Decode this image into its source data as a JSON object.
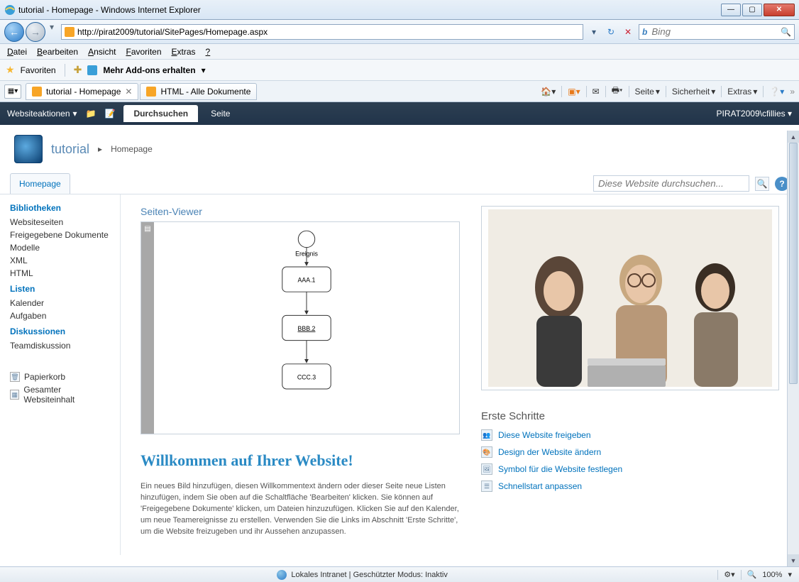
{
  "window": {
    "title": "tutorial - Homepage - Windows Internet Explorer"
  },
  "addressbar": {
    "url": "http://pirat2009/tutorial/SitePages/Homepage.aspx"
  },
  "searchbox": {
    "engine": "Bing",
    "placeholder": ""
  },
  "menubar": [
    "Datei",
    "Bearbeiten",
    "Ansicht",
    "Favoriten",
    "Extras",
    "?"
  ],
  "favbar": {
    "label": "Favoriten",
    "addons": "Mehr Add-ons erhalten"
  },
  "browserTabs": [
    {
      "label": "tutorial - Homepage",
      "active": true
    },
    {
      "label": "HTML - Alle Dokumente",
      "active": false
    }
  ],
  "cmdbar": {
    "seite": "Seite",
    "sicherheit": "Sicherheit",
    "extras": "Extras"
  },
  "ribbon": {
    "siteactions": "Websiteaktionen",
    "tabs": [
      "Durchsuchen",
      "Seite"
    ],
    "user": "PIRAT2009\\cfillies"
  },
  "breadcrumb": {
    "site": "tutorial",
    "page": "Homepage"
  },
  "toplink": {
    "tab": "Homepage",
    "searchPlaceholder": "Diese Website durchsuchen..."
  },
  "quicklaunch": {
    "h1": "Bibliotheken",
    "libs": [
      "Websiteseiten",
      "Freigegebene Dokumente",
      "Modelle",
      "XML",
      "HTML"
    ],
    "h2": "Listen",
    "lists": [
      "Kalender",
      "Aufgaben"
    ],
    "h3": "Diskussionen",
    "disc": [
      "Teamdiskussion"
    ],
    "recycle": "Papierkorb",
    "allcontent": "Gesamter Websiteinhalt"
  },
  "viewer": {
    "title": "Seiten-Viewer",
    "n0": "Ereignis",
    "n1": "AAA.1",
    "n2": "BBB.2",
    "n3": "CCC.3"
  },
  "welcome": {
    "heading": "Willkommen auf Ihrer Website!",
    "body": "Ein neues Bild hinzufügen, diesen Willkommentext ändern oder dieser Seite neue Listen hinzufügen, indem Sie oben auf die Schaltfläche 'Bearbeiten' klicken. Sie können auf 'Freigegebene Dokumente' klicken, um Dateien hinzuzufügen. Klicken Sie auf den Kalender, um neue Teamereignisse zu erstellen. Verwenden Sie die Links im Abschnitt 'Erste Schritte', um die Website freizugeben und ihr Aussehen anzupassen."
  },
  "gettingStarted": {
    "heading": "Erste Schritte",
    "links": [
      "Diese Website freigeben",
      "Design der Website ändern",
      "Symbol für die Website festlegen",
      "Schnellstart anpassen"
    ]
  },
  "status": {
    "zone": "Lokales Intranet | Geschützter Modus: Inaktiv",
    "zoom": "100%"
  }
}
